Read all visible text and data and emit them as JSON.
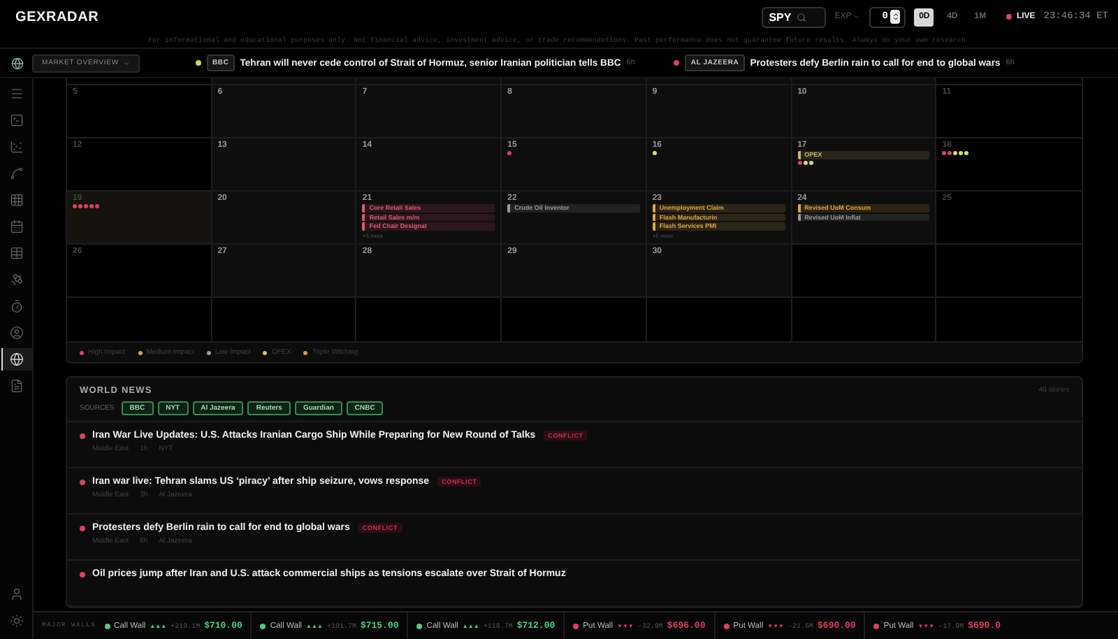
{
  "header": {
    "logo": "GEXRADAR",
    "symbol": "SPY",
    "exp_label": "EXP",
    "dte": "0",
    "ranges": [
      {
        "label": "0D",
        "selected": true
      },
      {
        "label": "4D",
        "selected": false
      },
      {
        "label": "1M",
        "selected": false
      }
    ],
    "live": "LIVE",
    "time": "23:46:34 ET"
  },
  "disclaimer": "For informational and educational purposes only. Not financial advice, investment advice, or trade recommendations. Past performance does not guarantee future results. Always do your own research.",
  "ticker": {
    "menu": "MARKET OVERVIEW",
    "items": [
      {
        "color": "#c8d46a",
        "source": "BBC",
        "headline": "Tehran will never cede control of Strait of Hormuz, senior Iranian politician tells BBC",
        "age": "6h"
      },
      {
        "color": "#e0405e",
        "source": "AL JAZEERA",
        "headline": "Protesters defy Berlin rain to call for end to global wars",
        "age": "6h"
      }
    ]
  },
  "sidebar": {
    "items": [
      {
        "selected": false
      },
      {
        "selected": false
      },
      {
        "selected": false
      },
      {
        "selected": false
      },
      {
        "selected": false
      },
      {
        "selected": false
      },
      {
        "selected": false
      },
      {
        "selected": false
      },
      {
        "selected": false
      },
      {
        "selected": false
      },
      {
        "selected": true
      },
      {
        "selected": false
      }
    ],
    "footer_items": [
      {
        "selected": false
      },
      {
        "selected": false
      }
    ]
  },
  "calendar": {
    "weeks": [
      {
        "days": [
          {
            "day": "5"
          },
          {
            "day": "6"
          },
          {
            "day": "7"
          },
          {
            "day": "8"
          },
          {
            "day": "9"
          },
          {
            "day": "10"
          },
          {
            "day": "11"
          }
        ]
      },
      {
        "days": [
          {
            "day": "12"
          },
          {
            "day": "13"
          },
          {
            "day": "14"
          },
          {
            "day": "15",
            "dots": [
              {
                "color": "#e0405e"
              }
            ]
          },
          {
            "day": "16",
            "dots": [
              {
                "color": "#d8e060"
              }
            ]
          },
          {
            "day": "17",
            "events": [
              {
                "title": "OPEX",
                "color": "#c9b96a"
              }
            ],
            "dots": [
              {
                "color": "#e0405e"
              },
              {
                "color": "#d8e060"
              },
              {
                "color": "#d8e060"
              }
            ]
          },
          {
            "day": "18",
            "dots": [
              {
                "color": "#e0405e"
              },
              {
                "color": "#e0405e"
              },
              {
                "color": "#d8e060"
              },
              {
                "color": "#d8e060"
              },
              {
                "color": "#d8e060"
              }
            ]
          }
        ]
      },
      {
        "days": [
          {
            "day": "19",
            "today": true,
            "dots": [
              {
                "color": "#e0405e"
              },
              {
                "color": "#e0405e"
              },
              {
                "color": "#e0405e"
              },
              {
                "color": "#e0405e"
              },
              {
                "color": "#e0405e"
              }
            ]
          },
          {
            "day": "20"
          },
          {
            "day": "21",
            "events": [
              {
                "title": "Core Retail Sales",
                "color": "#e05a70"
              },
              {
                "title": "Retail Sales m/m",
                "color": "#e05a70"
              },
              {
                "title": "Fed Chair Designat",
                "color": "#e05a70"
              }
            ],
            "more": "+5 more"
          },
          {
            "day": "22",
            "events": [
              {
                "title": "Crude Oil Inventor",
                "color": "#9a9a9a"
              }
            ]
          },
          {
            "day": "23",
            "events": [
              {
                "title": "Unemployment Claim",
                "color": "#e0a646"
              },
              {
                "title": "Flash Manufacturin",
                "color": "#e0a646"
              },
              {
                "title": "Flash Services PMI",
                "color": "#e0a646"
              }
            ],
            "more": "+5 more"
          },
          {
            "day": "24",
            "events": [
              {
                "title": "Revised UoM Consum",
                "color": "#e0a646"
              },
              {
                "title": "Revised UoM Inflat",
                "color": "#9a9a9a"
              }
            ]
          },
          {
            "day": "25"
          }
        ]
      },
      {
        "days": [
          {
            "day": "26"
          },
          {
            "day": "27"
          },
          {
            "day": "28"
          },
          {
            "day": "29"
          },
          {
            "day": "30"
          }
        ]
      }
    ],
    "legend": [
      {
        "label": "High Impact",
        "color": "#e0405e"
      },
      {
        "label": "Medium Impact",
        "color": "#e0a040"
      },
      {
        "label": "Low Impact",
        "color": "#9a9a9a"
      },
      {
        "label": "OPEX",
        "color": "#d4c060"
      },
      {
        "label": "Triple Witching",
        "color": "#e09a30"
      }
    ]
  },
  "news": {
    "title": "WORLD NEWS",
    "count": "40 stories",
    "sources_label": "SOURCES",
    "sources": [
      {
        "label": "BBC",
        "active": true
      },
      {
        "label": "NYT",
        "active": true
      },
      {
        "label": "Al Jazeera",
        "active": true
      },
      {
        "label": "Reuters",
        "active": true
      },
      {
        "label": "Guardian",
        "active": true
      },
      {
        "label": "CNBC",
        "active": true
      }
    ],
    "items": [
      {
        "title": "Iran War Live Updates: U.S. Attacks Iranian Cargo Ship While Preparing for New Round of Talks",
        "tag": "CONFLICT",
        "region": "Middle East",
        "age": "1h",
        "source": "NYT"
      },
      {
        "title": "Iran war live: Tehran slams US ‘piracy’ after ship seizure, vows response",
        "tag": "CONFLICT",
        "region": "Middle East",
        "age": "3h",
        "source": "Al Jazeera"
      },
      {
        "title": "Protesters defy Berlin rain to call for end to global wars",
        "tag": "CONFLICT",
        "region": "Middle East",
        "age": "6h",
        "source": "Al Jazeera"
      },
      {
        "title": "Oil prices jump after Iran and U.S. attack commercial ships as tensions escalate over Strait of Hormuz"
      }
    ]
  },
  "walls": {
    "label": "MAJOR WALLS",
    "items": [
      {
        "kind": "call",
        "name": "Call Wall",
        "strength": "▲▲▲",
        "change": "+219.1M",
        "price": "$710.00"
      },
      {
        "kind": "call",
        "name": "Call Wall",
        "strength": "▲▲▲",
        "change": "+191.7M",
        "price": "$715.00"
      },
      {
        "kind": "call",
        "name": "Call Wall",
        "strength": "▲▲▲",
        "change": "+118.7M",
        "price": "$712.00"
      },
      {
        "kind": "put",
        "name": "Put Wall",
        "strength": "▼▼▼",
        "change": "-32.9M",
        "price": "$696.00"
      },
      {
        "kind": "put",
        "name": "Put Wall",
        "strength": "▼▼▼",
        "change": "-21.6M",
        "price": "$690.00"
      },
      {
        "kind": "put",
        "name": "Put Wall",
        "strength": "▼▼▼",
        "change": "-17.9M",
        "price": "$690.0"
      }
    ]
  }
}
